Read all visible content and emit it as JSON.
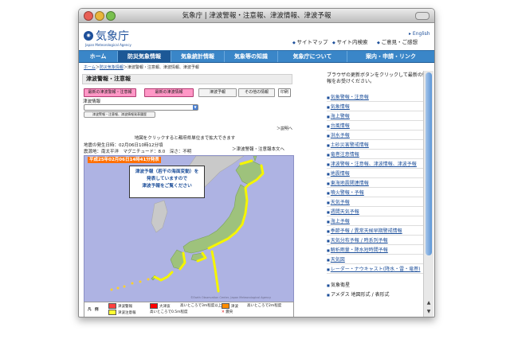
{
  "window": {
    "title": "気象庁 | 津波警報・注意報、津波情報、津波予報"
  },
  "header": {
    "logo_text": "気象庁",
    "logo_sub": "Japan Meteorological Agency",
    "english": "English",
    "util_links": [
      "サイトマップ",
      "サイト内検索",
      "ご意見・ご感想"
    ]
  },
  "nav": [
    "ホーム",
    "防災気象情報",
    "気象統計情報",
    "気象等の知識",
    "気象庁について",
    "案内・申請・リンク"
  ],
  "breadcrumb": {
    "home": "ホーム",
    "sep": "＞",
    "section": "防災気象情報",
    "current": "＞津波警報・注意報、津波情報、津波予報"
  },
  "main": {
    "title": "津波警報・注意報",
    "buttons": [
      "最新の津波警報・注意報",
      "最新の津波情報",
      "津波予報",
      "その他の情報",
      "印刷"
    ],
    "tsunami_label": "津波情報",
    "small_button": "津波警報・注意報、津波情報発表履歴",
    "explanation": "＞説明へ",
    "click_hint": "地図をクリックすると都府県単位まで拡大できます",
    "occurrence": "地震の発生日時：02月06日10時12分頃",
    "epicenter": "震源地：南太平洋　マグニチュード：8.0　深さ：不明",
    "to_text": "＞津波警報・注意報本文へ",
    "timestamp": "平成25年02月06日14時41分発表",
    "notice": [
      "津波予報（若干の海面変動）を",
      "発表していますので",
      "津波予報をご覧ください"
    ],
    "copyright": "©Earth Observation Center, Japan Meteorological Agency",
    "legend": {
      "title": "凡　例",
      "items": [
        "津波警報",
        "大津波",
        "高いところで3m程度以上",
        "津波注意報",
        "高いところで0.5m程度",
        "津波",
        "高いところで2m程度",
        "震央"
      ],
      "colors": {
        "major": "#ff0000",
        "warning": "#ff8c00",
        "advisory": "#ffff33"
      }
    }
  },
  "sidebar": {
    "head": "ブラウザの更新ボタンをクリックして最新の情報をお受けください。",
    "items": [
      "気象警報・注意報",
      "気象情報",
      "海上警報",
      "台風情報",
      "洪水予報",
      "土砂災害警戒情報",
      "竜巻注意情報",
      "津波警報・注意報、津波情報、津波予報",
      "地震情報",
      "東海地震関連情報",
      "噴火警報・予報",
      "天気予報",
      "週間天気予報",
      "海上予報",
      "季節予報 / 異常天候早期警戒情報",
      "天気分布予報 / 時系列予報",
      "解析雨量・降水短時間予報",
      "天気図",
      "レーダー・ナウキャスト(降水・雷・竜巻)",
      "気象衛星",
      "アメダス 地図形式 / 表形式"
    ]
  }
}
